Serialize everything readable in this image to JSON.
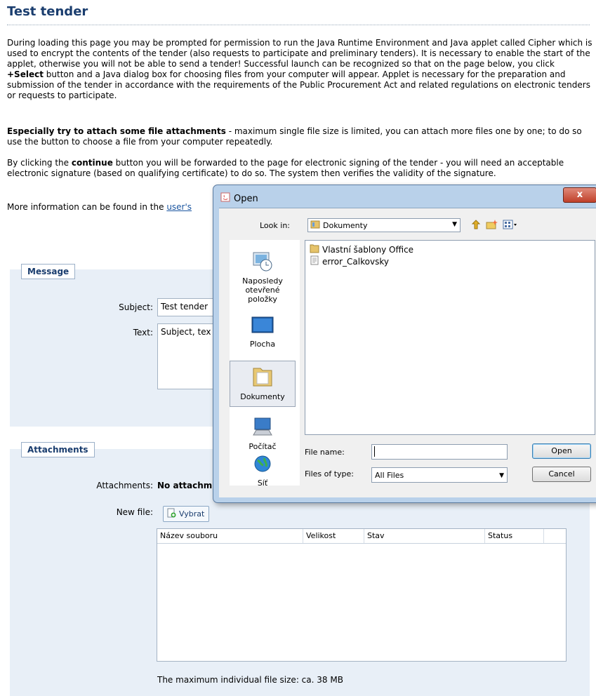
{
  "page": {
    "title": "Test tender",
    "intro": "During loading this page you may be prompted for permission to run the Java Runtime Environment and Java applet called Cipher which is used to encrypt the contents of the tender (also requests to participate and preliminary tenders). It is necessary to enable the start of the applet, otherwise you will not be able to send a tender! Successful launch can be recognized so that on the page below, you click",
    "intro_bold": "+Select",
    "intro_rest": "button and a Java dialog box for choosing files from your computer will appear. Applet is necessary for the preparation and submission of the tender in accordance with the requirements of the Public Procurement Act and related regulations on electronic tenders or requests to participate.",
    "attach_bold": "Especially try to attach some file attachments",
    "attach_rest": "- maximum single file size is limited, you can attach more files one by one; to do so use the button to choose a file from your computer repeatedly.",
    "continue_pre": "By clicking the",
    "continue_bold": "continue",
    "continue_rest": "button you will be forwarded to the page for electronic signing of the tender - you will need an acceptable electronic signature (based on qualifying certificate) to do so. The system then verifies the validity of the signature.",
    "more_info": "More information can be found in the",
    "more_link": "user's"
  },
  "message": {
    "legend": "Message",
    "subject_label": "Subject:",
    "subject_value": "Test tender",
    "text_label": "Text:",
    "text_value": "Subject, tex"
  },
  "attachments": {
    "legend": "Attachments",
    "attachments_label": "Attachments:",
    "attachments_value": "No attachm",
    "newfile_label": "New file:",
    "select_button": "Vybrat",
    "columns": [
      "Název souboru",
      "Velikost",
      "Stav",
      "Status"
    ],
    "max_size_note": "The maximum individual file size: ca. 38 MB"
  },
  "dialog": {
    "title": "Open",
    "close": "x",
    "look_in_label": "Look in:",
    "look_in_value": "Dokumenty",
    "places": [
      "Naposledy otevřené položky",
      "Plocha",
      "Dokumenty",
      "Počítač",
      "Síť"
    ],
    "selected_place": "Dokumenty",
    "files": [
      "Vlastní šablony Office",
      "error_Calkovsky"
    ],
    "file_name_label": "File name:",
    "file_name_value": "",
    "files_of_type_label": "Files of type:",
    "files_of_type_value": "All Files",
    "open_button": "Open",
    "cancel_button": "Cancel"
  }
}
